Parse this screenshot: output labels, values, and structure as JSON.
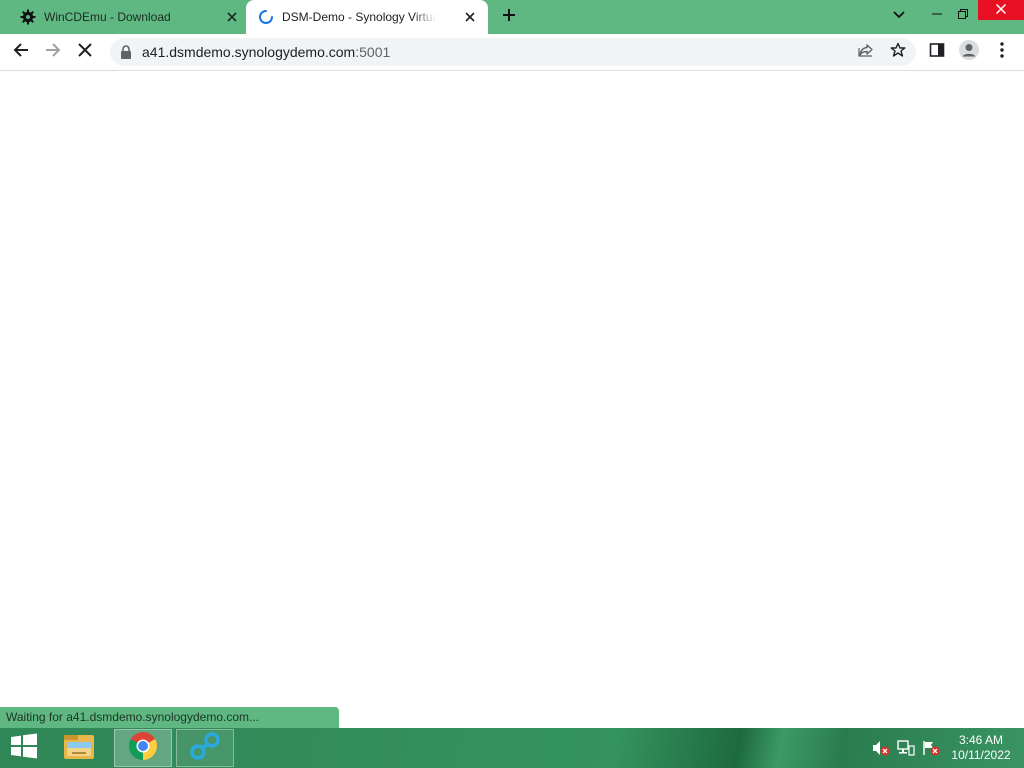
{
  "browser": {
    "tabs": [
      {
        "title": "WinCDEmu - Download",
        "favicon": "gear-icon",
        "active": false
      },
      {
        "title": "DSM-Demo - Synology VirtualDSM",
        "favicon": "loading-spinner-icon",
        "active": true
      }
    ],
    "new_tab_icon": "plus-icon",
    "window_controls": [
      "tab-search-icon",
      "minimize-icon",
      "restore-icon",
      "close-icon"
    ]
  },
  "toolbar": {
    "url_host": "a41.dsmdemo.synologydemo.com",
    "url_port": ":5001",
    "buttons": [
      "back-arrow-icon",
      "forward-arrow-icon",
      "stop-loading-icon",
      "share-icon",
      "bookmark-star-icon",
      "side-panel-icon",
      "profile-icon",
      "menu-dots-icon"
    ]
  },
  "status": {
    "text": "Waiting for a41.dsmdemo.synologydemo.com..."
  },
  "taskbar": {
    "apps": [
      "file-explorer-icon",
      "chrome-icon",
      "network-app-icon"
    ],
    "tray": [
      "speaker-muted-icon",
      "network-icon",
      "action-center-flag-icon"
    ],
    "time": "3:46 AM",
    "date": "10/11/2022"
  },
  "colors": {
    "accent": "#5fb882",
    "taskbar": "#2f8656",
    "close_hover": "#e81123"
  }
}
